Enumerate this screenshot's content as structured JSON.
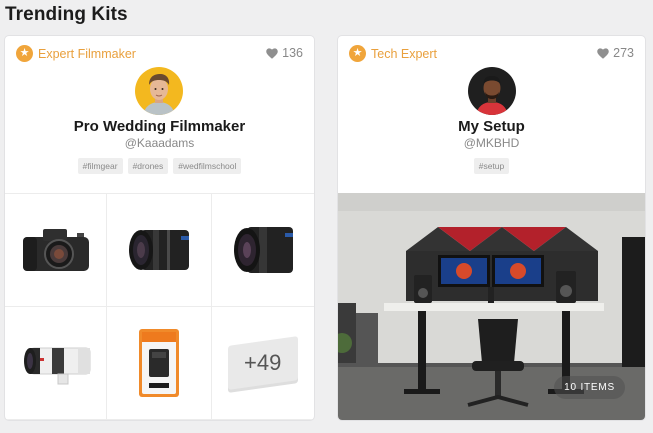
{
  "section": {
    "title": "Trending Kits"
  },
  "kits": [
    {
      "badge": "Expert Filmmaker",
      "likes": "136",
      "title": "Pro Wedding Filmmaker",
      "user": "@Kaaadams",
      "tags": [
        "#filmgear",
        "#drones",
        "#wedfilmschool"
      ],
      "more_count": "+49",
      "items": [
        "mirrorless-camera",
        "zoom-lens",
        "prime-lens",
        "telephoto-lens",
        "camera-battery"
      ]
    },
    {
      "badge": "Tech Expert",
      "likes": "273",
      "title": "My Setup",
      "user": "@MKBHD",
      "tags": [
        "#setup"
      ],
      "items_label": "10 ITEMS"
    }
  ],
  "colors": {
    "accent": "#f0a53b",
    "badge_text": "#e9a03d",
    "muted": "#888888"
  }
}
